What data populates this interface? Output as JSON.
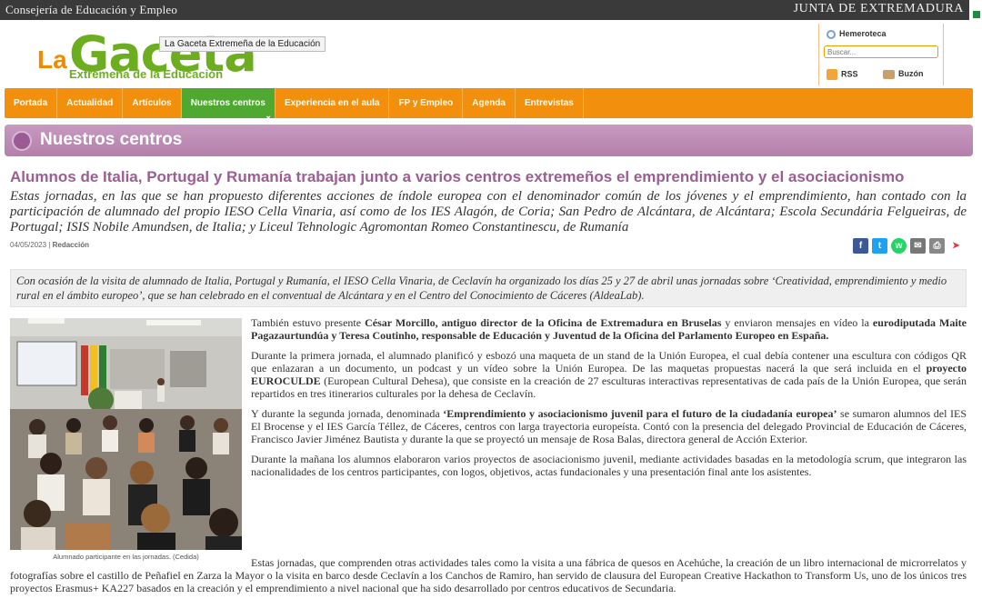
{
  "topbar": {
    "left": "Consejería de Educación y Empleo",
    "right": "JUNTA DE EXTREMADURA"
  },
  "logo": {
    "la": "La",
    "gaceta": "Gaceta",
    "sub": "Extremeña de la Educación",
    "tooltip": "La Gaceta Extremeña de la Educación"
  },
  "tools": {
    "hemeroteca": "Hemeroteca",
    "search_placeholder": "Buscar...",
    "rss": "RSS",
    "buzon": "Buzón"
  },
  "nav": {
    "items": [
      {
        "label": "Portada"
      },
      {
        "label": "Actualidad"
      },
      {
        "label": "Artículos"
      },
      {
        "label": "Nuestros centros"
      },
      {
        "label": "Experiencia en el aula"
      },
      {
        "label": "FP y Empleo"
      },
      {
        "label": "Agenda"
      },
      {
        "label": "Entrevistas"
      }
    ],
    "active": "Nuestros centros"
  },
  "section": {
    "title": "Nuestros centros"
  },
  "article": {
    "headline": "Alumnos de Italia, Portugal y Rumanía trabajan junto a varios centros extremeños el emprendimiento y el asociacionismo",
    "lead": "Estas jornadas, en las que se han propuesto diferentes acciones de índole europea con el denominador común de los jóvenes y el emprendimiento, han contado con la participación de alumnado del propio IESO Cella Vinaria, así como de los IES Alagón, de Coria; San Pedro de Alcántara, de Alcántara; Escola Secundária Felgueiras, de Portugal; ISIS Nobile Amundsen, de Italia; y Liceul Tehnologic Agromontan Romeo Constantinescu, de Rumanía",
    "date": "04/05/2023",
    "separator": "|",
    "author": "Redacción",
    "intro": "Con ocasión de la visita de alumnado de Italia, Portugal y Rumanía, el IESO Cella Vinaria, de Ceclavín ha organizado los días 25 y 27 de abril unas jornadas sobre ‘Creatividad, emprendimiento y medio rural en el ámbito europeo’, que se han celebrado en el conventual de Alcántara y en el Centro del Conocimiento de Cáceres (AldeaLab).",
    "caption": "Alumnado participante en las jornadas. (Cedida)",
    "p1": {
      "a": "También estuvo presente ",
      "b": "César Morcillo, antiguo director de la Oficina de Extremadura en Bruselas",
      "c": " y enviaron mensajes en vídeo la ",
      "d": "eurodiputada Maite Pagazaurtundúa y Teresa Coutinho, responsable de Educación y Juventud de la Oficina del Parlamento Europeo en España."
    },
    "p2": {
      "a": "Durante la primera jornada, el alumnado planificó y esbozó una maqueta de un stand de la Unión Europea, el cual debía contener una escultura con códigos QR que enlazaran a un documento, un podcast y un vídeo sobre la Unión Europea. De las maquetas propuestas nacerá la que será incluida en el ",
      "b": "proyecto EUROCULDE",
      "c": " (European Cultural Dehesa), que consiste en la creación de 27 esculturas interactivas representativas de cada país de la Unión Europea, que serán repartidos en tres itinerarios culturales por la dehesa de Ceclavín."
    },
    "p3": {
      "a": "Y durante la segunda jornada, denominada ",
      "b": "‘Emprendimiento y asociacionismo juvenil para el futuro de la ciudadanía europea’",
      "c": " se sumaron alumnos del IES El Brocense y el IES García Téllez, de Cáceres, centros con larga trayectoria europeísta. Contó con la presencia del delegado Provincial de Educación de Cáceres, Francisco Javier Jiménez Bautista y durante la que se proyectó un mensaje de Rosa Balas, directora general de Acción Exterior."
    },
    "p4": "Durante la mañana los alumnos elaboraron varios proyectos de asociacionismo juvenil, mediante actividades basadas en la metodología scrum, que integraron las nacionalidades de los centros participantes, con logos, objetivos, actas fundacionales y una presentación final ante los asistentes.",
    "p5a": "Estas jornadas, que comprenden otras actividades tales como la visita a una fábrica de quesos en Acehúche, la creación de un libro internacional de microrrelatos y fotografías sobre el castillo de Peñafiel en Zarza la Mayor o la visita en barco desde Ceclavín a los Canchos de Ramiro, han",
    "p5b": "servido de clausura del European Creative Hackathon to Transform Us, uno de los únicos tres proyectos Erasmus+ KA227 basados en la creación y el emprendimiento a nivel nacional que ha sido desarrollado por centros educativos de Secundaria."
  },
  "share": {
    "facebook": "f",
    "twitter": "t",
    "whatsapp": "w",
    "email": "✉",
    "print": "⎙",
    "pdf": "➤"
  },
  "colors": {
    "nav": "#f28f0c",
    "nav_active": "#4fa82f",
    "section": "#b47fab",
    "headline": "#9b5e92",
    "logo_green": "#6cae1f",
    "logo_orange": "#f08a00"
  }
}
